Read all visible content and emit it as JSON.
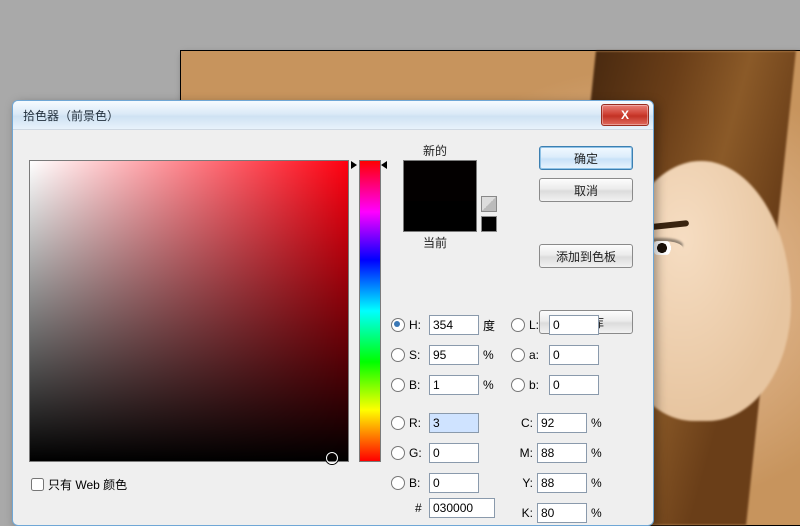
{
  "dialog": {
    "title": "拾色器（前景色）",
    "close_label": "X"
  },
  "buttons": {
    "ok": "确定",
    "cancel": "取消",
    "add_swatch": "添加到色板",
    "libraries": "颜色库"
  },
  "swatch": {
    "new_label": "新的",
    "current_label": "当前"
  },
  "hsb": {
    "h_label": "H:",
    "h_value": "354",
    "h_unit": "度",
    "s_label": "S:",
    "s_value": "95",
    "s_unit": "%",
    "b_label": "B:",
    "b_value": "1",
    "b_unit": "%",
    "selected": "H"
  },
  "rgb": {
    "r_label": "R:",
    "r_value": "3",
    "g_label": "G:",
    "g_value": "0",
    "b_label": "B:",
    "b_value": "0"
  },
  "lab": {
    "l_label": "L:",
    "l_value": "0",
    "a_label": "a:",
    "a_value": "0",
    "b_label": "b:",
    "b_value": "0"
  },
  "cmyk": {
    "c_label": "C:",
    "c_value": "92",
    "unit": "%",
    "m_label": "M:",
    "m_value": "88",
    "y_label": "Y:",
    "y_value": "88",
    "k_label": "K:",
    "k_value": "80"
  },
  "hex": {
    "prefix": "#",
    "value": "030000"
  },
  "web_only": {
    "label": "只有 Web 颜色",
    "checked": false
  },
  "picker": {
    "hue_fraction": 0.0167,
    "sv_x_fraction": 0.95,
    "sv_y_fraction": 0.99
  },
  "colors": {
    "new": "#030000",
    "current": "#000000",
    "hue_base": "#ff0010"
  }
}
